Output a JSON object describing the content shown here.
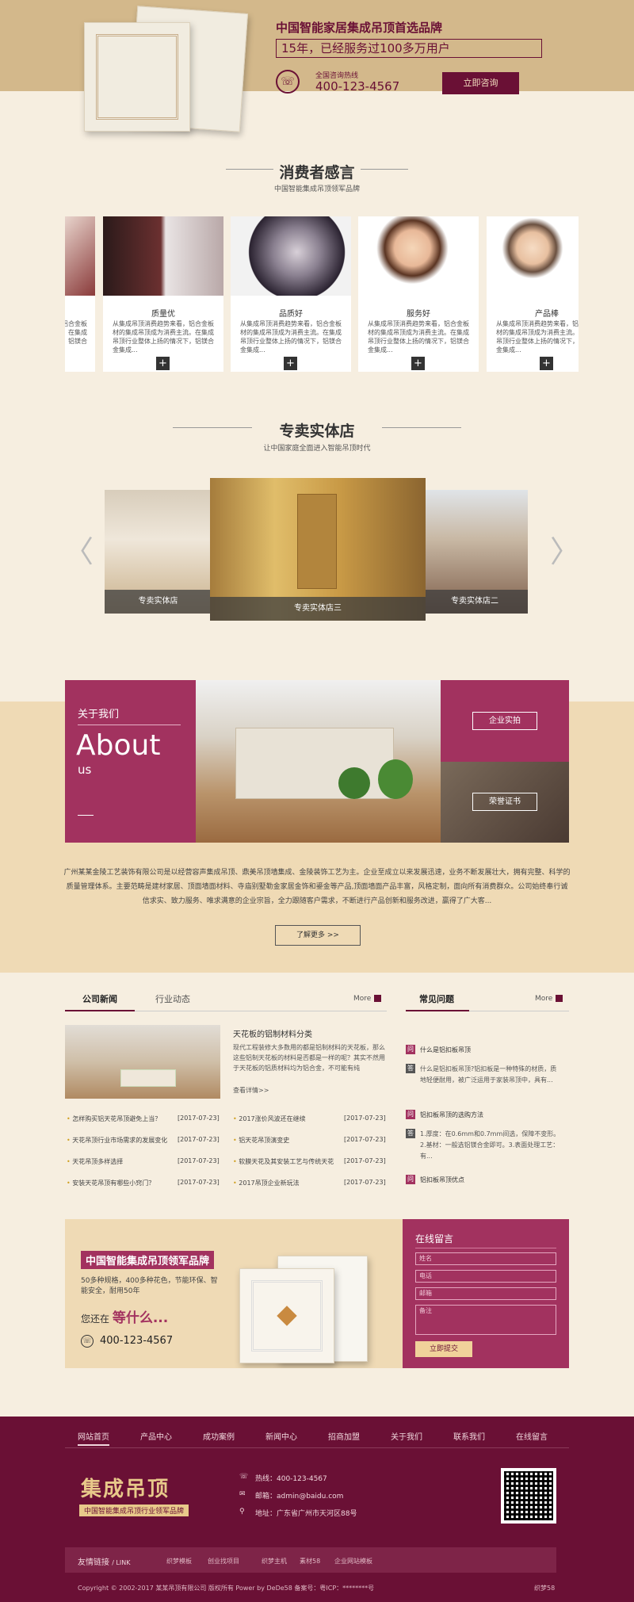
{
  "hero": {
    "title": "中国智能家居集成吊顶首选品牌",
    "subtitle": "15年，已经服务过100多万用户",
    "hotline_label": "全国咨询热线",
    "phone": "400-123-4567",
    "cta": "立即咨询"
  },
  "testimonials": {
    "heading": "消费者感言",
    "subheading": "中国智能集成吊顶领军品牌",
    "cards": [
      {
        "title": "质量优",
        "text": "从集成吊顶消费趋势来看，铝合金板材的集成吊顶成为消费主流。在集成吊顶行业整体上扬的情况下，铝镁合金集成..."
      },
      {
        "title": "品质好",
        "text": "从集成吊顶消费趋势来看，铝合金板材的集成吊顶成为消费主流。在集成吊顶行业整体上扬的情况下，铝镁合金集成..."
      },
      {
        "title": "服务好",
        "text": "从集成吊顶消费趋势来看，铝合金板材的集成吊顶成为消费主流。在集成吊顶行业整体上扬的情况下，铝镁合金集成..."
      },
      {
        "title": "产品棒",
        "text": "从集成吊顶消费趋势来看，铝合金板材的集成吊顶成为消费主流。在集成吊顶行业整体上扬的情况下，铝镁合金集成..."
      }
    ],
    "partial_text": "从集成吊顶消费趋势来看，铝合金板材的集成吊顶成为消费主流。在集成吊顶行业整体上扬的情况下，铝镁合金集成..."
  },
  "stores": {
    "heading": "专卖实体店",
    "subheading": "让中国家庭全面进入智能吊顶时代",
    "left_caption": "专卖实体店",
    "center_caption": "专卖实体店三",
    "right_caption": "专卖实体店二"
  },
  "about": {
    "label": "关于我们",
    "big": "About",
    "small": "us",
    "btn1": "企业实拍",
    "btn2": "荣誉证书",
    "text": "广州某某金陵工艺装饰有限公司是以经营容声集成吊顶、鼎美吊顶墙集成、金陵装饰工艺为主。企业至成立以来发展迅速，业务不断发展壮大，拥有完整、科学的质量管理体系。主要范畴是建材家居、顶面墙面材料、寺庙别墅勒金家居金饰和鎏金等产品,顶面墙面产品丰富，风格定制，面向所有消费群众。公司始终奉行诚信求实、致力服务、唯求满意的企业宗旨，全力跟随客户需求，不断进行产品创新和服务改进，赢得了广大客...",
    "more": "了解更多 >>"
  },
  "news": {
    "tab_active": "公司新闻",
    "tab_other": "行业动态",
    "more": "More",
    "feature_title": "天花板的铝制材料分类",
    "feature_text": "现代工程装修大多数用的都是铝制材料的天花板，那么这些铝制天花板的材料是否都是一样的呢？其实不然用于天花板的铝质材料均为铝合金，不可能有纯",
    "feature_link": "查看详情>>",
    "col1": [
      {
        "title": "怎样购买铝天花吊顶避免上当？",
        "date": "[2017-07-23]"
      },
      {
        "title": "天花吊顶行业市场需求的发展变化",
        "date": "[2017-07-23]"
      },
      {
        "title": "天花吊顶多样选择",
        "date": "[2017-07-23]"
      },
      {
        "title": "安装天花吊顶有哪些小窍门？",
        "date": "[2017-07-23]"
      }
    ],
    "col2": [
      {
        "title": "2017涨价风波还在继续",
        "date": "[2017-07-23]"
      },
      {
        "title": "铝天花吊顶演变史",
        "date": "[2017-07-23]"
      },
      {
        "title": "软膜天花及其安装工艺与传统天花",
        "date": "[2017-07-23]"
      },
      {
        "title": "2017吊顶企业新玩法",
        "date": "[2017-07-23]"
      }
    ]
  },
  "faq": {
    "heading": "常见问题",
    "more": "More",
    "q_mark": "问",
    "a_mark": "答",
    "items": [
      {
        "q": "什么是铝扣板吊顶",
        "a": "什么是铝扣板吊顶?铝扣板是一种特殊的材质，质地轻便耐用，被广泛运用于家装吊顶中，具有..."
      },
      {
        "q": "铝扣板吊顶的选购方法",
        "a": "1.厚度：在0.6mm和0.7mm间选，保障不变形。2.基材：一般选铝镁合金即可。3.表面处理工艺：有..."
      },
      {
        "q": "铝扣板吊顶优点",
        "a": ""
      }
    ]
  },
  "promo": {
    "banner": "中国智能集成吊顶领军品牌",
    "desc": "50多种规格，400多种花色，节能环保、智能安全，耐用50年",
    "wait1": "您还在",
    "wait2": "等什么...",
    "phone": "400-123-4567"
  },
  "message": {
    "title": "在线留言",
    "name": "姓名",
    "tel": "电话",
    "email": "邮箱",
    "note": "备注",
    "submit": "立即提交"
  },
  "footer": {
    "nav": [
      "网站首页",
      "产品中心",
      "成功案例",
      "新闻中心",
      "招商加盟",
      "关于我们",
      "联系我们",
      "在线留言"
    ],
    "logo": "集成吊顶",
    "logo_sub": "中国智能集成吊顶行业领军品牌",
    "hotline": "热线：400-123-4567",
    "email": "邮箱：admin@baidu.com",
    "address": "地址：广东省广州市天河区88号",
    "links_label": "友情链接",
    "links_en": "/ LINK",
    "links": [
      "织梦模板",
      "创业找项目",
      "织梦主机",
      "素材58",
      "企业网站模板"
    ],
    "copyright": "Copyright © 2002-2017 某某吊顶有限公司 版权所有 Power by DeDe58  备案号：粤ICP：********号",
    "right": "织梦58"
  },
  "colors": {
    "accent": "#6a1035",
    "pink": "#a2325f",
    "gold": "#d3b88b",
    "cream": "#f6eee0"
  }
}
